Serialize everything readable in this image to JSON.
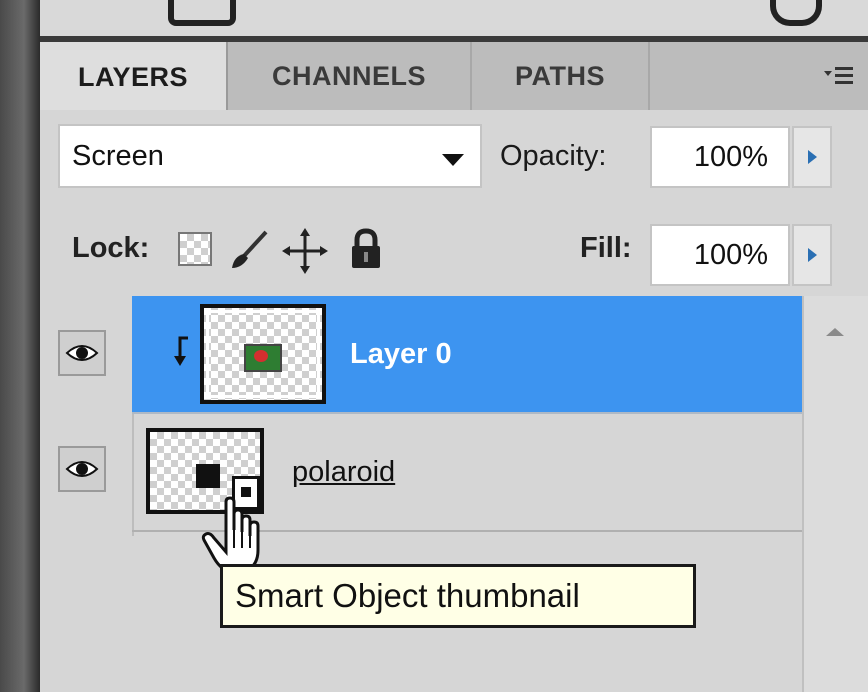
{
  "tabs": [
    {
      "label": "LAYERS",
      "active": true
    },
    {
      "label": "CHANNELS",
      "active": false
    },
    {
      "label": "PATHS",
      "active": false
    }
  ],
  "blend": {
    "mode": "Screen",
    "opacity_label": "Opacity:",
    "opacity_value": "100%"
  },
  "lock": {
    "label": "Lock:",
    "fill_label": "Fill:",
    "fill_value": "100%"
  },
  "layers": [
    {
      "name": "Layer 0",
      "selected": true,
      "visible": true,
      "clipped": true
    },
    {
      "name": "polaroid",
      "selected": false,
      "visible": true,
      "smart_object": true
    }
  ],
  "tooltip": "Smart Object thumbnail",
  "colors": {
    "selection": "#3d94f0",
    "panel_bg": "#d6d6d6",
    "tab_bar": "#bcbcbc"
  },
  "icons": [
    "panel-menu-icon",
    "dropdown-arrow-icon",
    "stepper-arrow-icon",
    "lock-transparency-icon",
    "lock-paint-icon",
    "lock-move-icon",
    "lock-all-icon",
    "eye-icon",
    "clip-arrow-icon",
    "smart-object-badge-icon",
    "hand-cursor-icon"
  ]
}
